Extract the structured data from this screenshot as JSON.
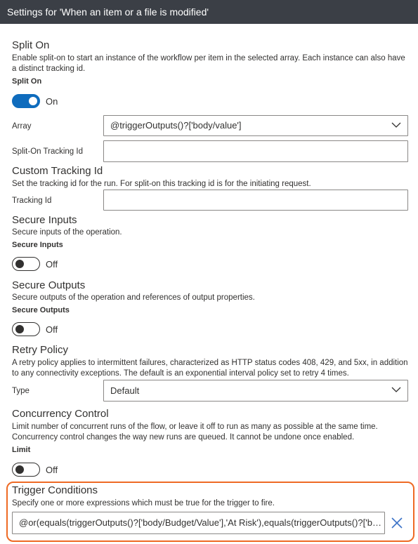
{
  "header": {
    "title": "Settings for 'When an item or a file is modified'"
  },
  "split_on": {
    "title": "Split On",
    "description": "Enable split-on to start an instance of the workflow per item in the selected array. Each instance can also have a distinct tracking id.",
    "toggle_label": "Split On",
    "toggle_state": "On",
    "array_label": "Array",
    "array_value": "@triggerOutputs()?['body/value']",
    "tracking_label": "Split-On Tracking Id",
    "tracking_value": ""
  },
  "custom_tracking": {
    "title": "Custom Tracking Id",
    "description": "Set the tracking id for the run. For split-on this tracking id is for the initiating request.",
    "field_label": "Tracking Id",
    "field_value": ""
  },
  "secure_inputs": {
    "title": "Secure Inputs",
    "description": "Secure inputs of the operation.",
    "toggle_label": "Secure Inputs",
    "toggle_state": "Off"
  },
  "secure_outputs": {
    "title": "Secure Outputs",
    "description": "Secure outputs of the operation and references of output properties.",
    "toggle_label": "Secure Outputs",
    "toggle_state": "Off"
  },
  "retry_policy": {
    "title": "Retry Policy",
    "description": "A retry policy applies to intermittent failures, characterized as HTTP status codes 408, 429, and 5xx, in addition to any connectivity exceptions. The default is an exponential interval policy set to retry 4 times.",
    "type_label": "Type",
    "type_value": "Default"
  },
  "concurrency": {
    "title": "Concurrency Control",
    "description": "Limit number of concurrent runs of the flow, or leave it off to run as many as possible at the same time. Concurrency control changes the way new runs are queued. It cannot be undone once enabled.",
    "toggle_label": "Limit",
    "toggle_state": "Off"
  },
  "trigger_conditions": {
    "title": "Trigger Conditions",
    "description": "Specify one or more expressions which must be true for the trigger to fire.",
    "condition_value": "@or(equals(triggerOutputs()?['body/Budget/Value'],'At Risk'),equals(triggerOutputs()?['body/Budget/Value'],'Off Track'))"
  },
  "colors": {
    "header_bg": "#3b3f46",
    "toggle_on": "#0f6cbd",
    "highlight": "#ee6a24",
    "remove_icon": "#3b73c8"
  },
  "icons": {
    "dropdown": "chevron-down-icon",
    "remove": "close-icon"
  }
}
